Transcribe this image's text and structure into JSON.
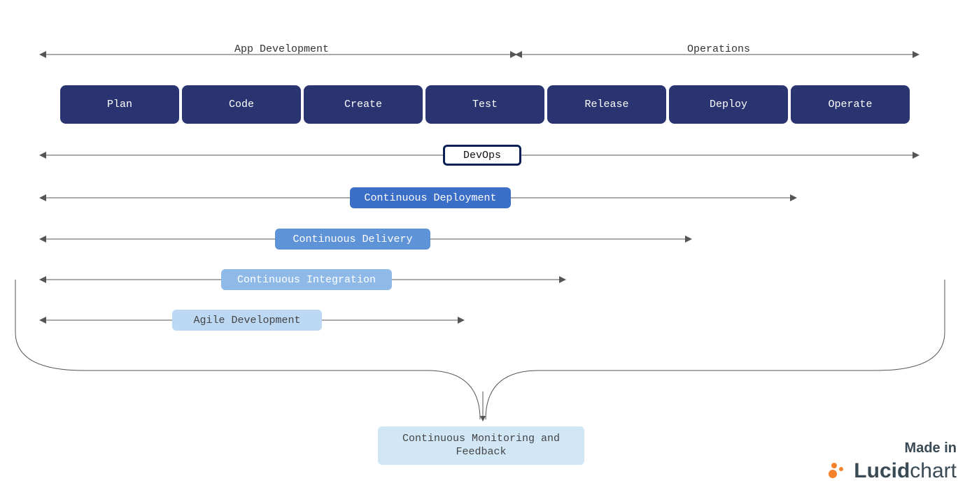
{
  "headers": {
    "left": "App Development",
    "right": "Operations"
  },
  "stages": [
    "Plan",
    "Code",
    "Create",
    "Test",
    "Release",
    "Deploy",
    "Operate"
  ],
  "ranges": {
    "devops": "DevOps",
    "continuous_deployment": "Continuous Deployment",
    "continuous_delivery": "Continuous Delivery",
    "continuous_integration": "Continuous Integration",
    "agile": "Agile Development"
  },
  "feedback": "Continuous Monitoring and\nFeedback",
  "watermark": {
    "madein": "Made in",
    "brand1": "Lucid",
    "brand2": "chart"
  }
}
